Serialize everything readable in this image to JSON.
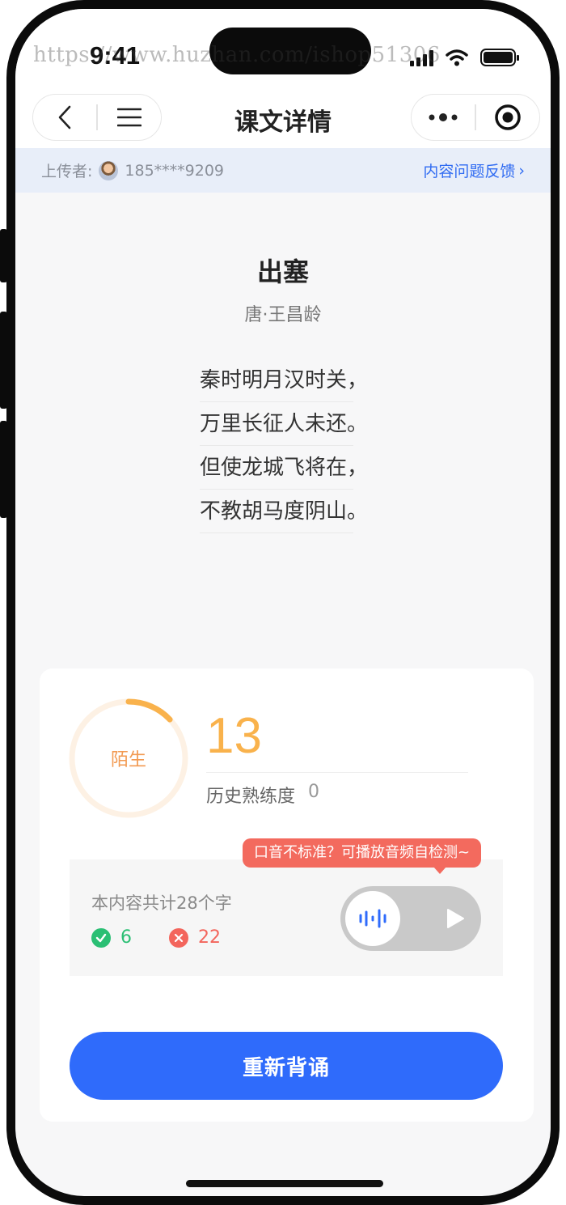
{
  "status_bar": {
    "time": "9:41",
    "watermark": "https://www.huzhan.com/ishop51306"
  },
  "nav": {
    "title": "课文详情"
  },
  "uploader": {
    "label": "上传者:",
    "phone": "185****9209",
    "feedback_link": "内容问题反馈",
    "feedback_chevron": "›"
  },
  "poem": {
    "title": "出塞",
    "author": "唐·王昌龄",
    "lines": [
      "秦时明月汉时关，",
      "万里长征人未还。",
      "但使龙城飞将在，",
      "不教胡马度阴山。"
    ]
  },
  "progress": {
    "level_label": "陌生",
    "score": "13",
    "history_label": "历史熟练度",
    "history_value": "0",
    "ring_fraction": 0.13,
    "colors": {
      "ring_track": "#fdf1e4",
      "ring_progress": "#f9b24c",
      "score": "#f9b24c"
    }
  },
  "check": {
    "tip": "口音不标准？可播放音频自检测~",
    "total_text": "本内容共计28个字",
    "correct_count": "6",
    "wrong_count": "22",
    "icons": {
      "correct": "check-circle-icon",
      "wrong": "x-circle-icon",
      "audio": "soundwave-icon",
      "play": "play-icon"
    },
    "colors": {
      "correct": "#2bbf74",
      "wrong": "#f3655c"
    }
  },
  "actions": {
    "restart_label": "重新背诵"
  },
  "colors": {
    "accent": "#2f6bfb",
    "link": "#2f6bf2"
  }
}
